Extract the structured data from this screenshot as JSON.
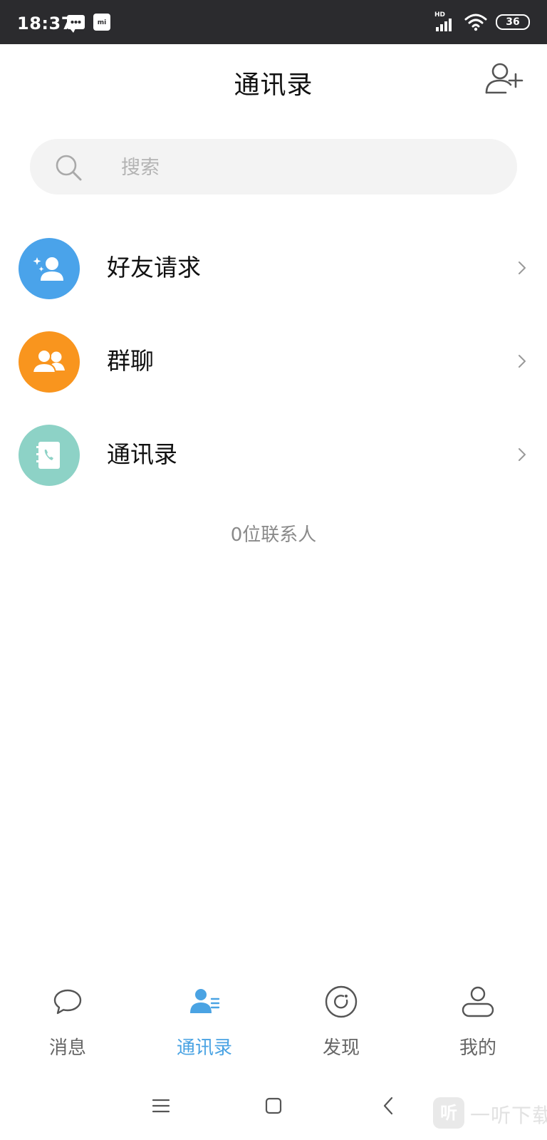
{
  "status_bar": {
    "time": "18:37",
    "network_label": "HD",
    "battery": "36"
  },
  "header": {
    "title": "通讯录",
    "add_icon": "add-user-icon"
  },
  "search": {
    "placeholder": "搜索"
  },
  "menu": {
    "items": [
      {
        "label": "好友请求",
        "icon": "friend-request-icon",
        "color": "#4aa3ea"
      },
      {
        "label": "群聊",
        "icon": "group-chat-icon",
        "color": "#f9951e"
      },
      {
        "label": "通讯录",
        "icon": "phonebook-icon",
        "color": "#8dd2c6"
      }
    ]
  },
  "contact_count": "0位联系人",
  "tabs": [
    {
      "label": "消息",
      "icon": "chat-bubble-icon",
      "active": false
    },
    {
      "label": "通讯录",
      "icon": "contacts-icon",
      "active": true
    },
    {
      "label": "发现",
      "icon": "discover-icon",
      "active": false
    },
    {
      "label": "我的",
      "icon": "profile-icon",
      "active": false
    }
  ],
  "colors": {
    "accent": "#4aa3e3",
    "status_bar_bg": "#2b2b2e"
  },
  "watermark": {
    "badge": "听",
    "text": "一听下载"
  }
}
